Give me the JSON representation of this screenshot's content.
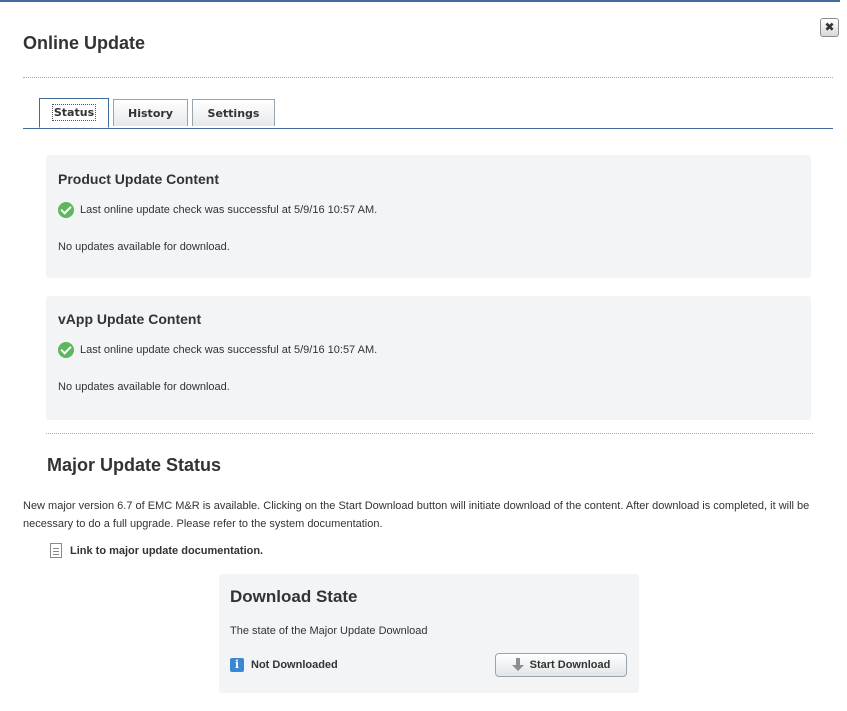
{
  "dialog": {
    "title": "Online Update",
    "close_icon": "close-icon"
  },
  "tabs": [
    {
      "label": "Status",
      "active": true
    },
    {
      "label": "History",
      "active": false
    },
    {
      "label": "Settings",
      "active": false
    }
  ],
  "product_update": {
    "title": "Product Update Content",
    "status": "Last online update check was successful at 5/9/16 10:57 AM.",
    "availability": "No updates available for download."
  },
  "vapp_update": {
    "title": "vApp Update Content",
    "status": "Last online update check was successful at 5/9/16 10:57 AM.",
    "availability": "No updates available for download."
  },
  "major_update": {
    "title": "Major Update Status",
    "description": "New major version 6.7 of EMC M&R is available. Clicking on the Start Download button will initiate download of the content. After download is completed, it will be necessary to do a full upgrade. Please refer to the system documentation.",
    "doc_link": "Link to major update documentation."
  },
  "download": {
    "title": "Download State",
    "description": "The state of the Major Update Download",
    "state": "Not Downloaded",
    "button_label": "Start Download"
  },
  "colors": {
    "accent": "#3f6e9e",
    "success": "#5cb85c",
    "info": "#3a87d6",
    "panel_bg": "#f3f4f6"
  }
}
